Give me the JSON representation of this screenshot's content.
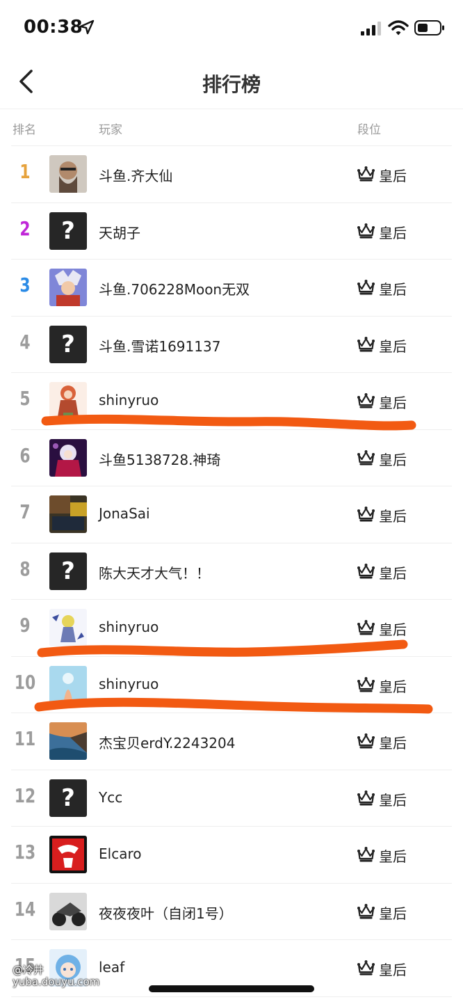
{
  "status_bar": {
    "time": "00:38"
  },
  "header": {
    "title": "排行榜"
  },
  "columns": {
    "rank": "排名",
    "player": "玩家",
    "tier": "段位"
  },
  "rank_colors": {
    "1": "#e6a23c",
    "2": "#c027d8",
    "3": "#2b8be6",
    "default": "#9c9c9c"
  },
  "rows": [
    {
      "rank": "1",
      "name": "斗鱼.齐大仙",
      "tier": "皇后",
      "avatar": "bearded-man"
    },
    {
      "rank": "2",
      "name": "天胡子",
      "tier": "皇后",
      "avatar": "unknown"
    },
    {
      "rank": "3",
      "name": "斗鱼.706228Moon无双",
      "tier": "皇后",
      "avatar": "anime-hero"
    },
    {
      "rank": "4",
      "name": "斗鱼.雪诺1691137",
      "tier": "皇后",
      "avatar": "unknown"
    },
    {
      "rank": "5",
      "name": "shinyruo",
      "tier": "皇后",
      "avatar": "anime-girl-red"
    },
    {
      "rank": "6",
      "name": "斗鱼5138728.神琦",
      "tier": "皇后",
      "avatar": "anime-girl-purple"
    },
    {
      "rank": "7",
      "name": "JonaSai",
      "tier": "皇后",
      "avatar": "photo-dark"
    },
    {
      "rank": "8",
      "name": "陈大天才大气！！",
      "tier": "皇后",
      "avatar": "unknown"
    },
    {
      "rank": "9",
      "name": "shinyruo",
      "tier": "皇后",
      "avatar": "anime-girl-white"
    },
    {
      "rank": "10",
      "name": "shinyruo",
      "tier": "皇后",
      "avatar": "sky-blue"
    },
    {
      "rank": "11",
      "name": "杰宝贝erdY.2243204",
      "tier": "皇后",
      "avatar": "seascape"
    },
    {
      "rank": "12",
      "name": "Ycc",
      "tier": "皇后",
      "avatar": "unknown"
    },
    {
      "rank": "13",
      "name": "Elcaro",
      "tier": "皇后",
      "avatar": "red-mask"
    },
    {
      "rank": "14",
      "name": "夜夜夜叶（自闭1号）",
      "tier": "皇后",
      "avatar": "motorbike"
    },
    {
      "rank": "15",
      "name": "leaf",
      "tier": "皇后",
      "avatar": "anime-blue-hair"
    }
  ],
  "unknown_avatar_glyph": "?",
  "highlight_color": "#f25a12",
  "watermark": {
    "line1": "@冷井",
    "line2": "yuba.douyu.com"
  }
}
